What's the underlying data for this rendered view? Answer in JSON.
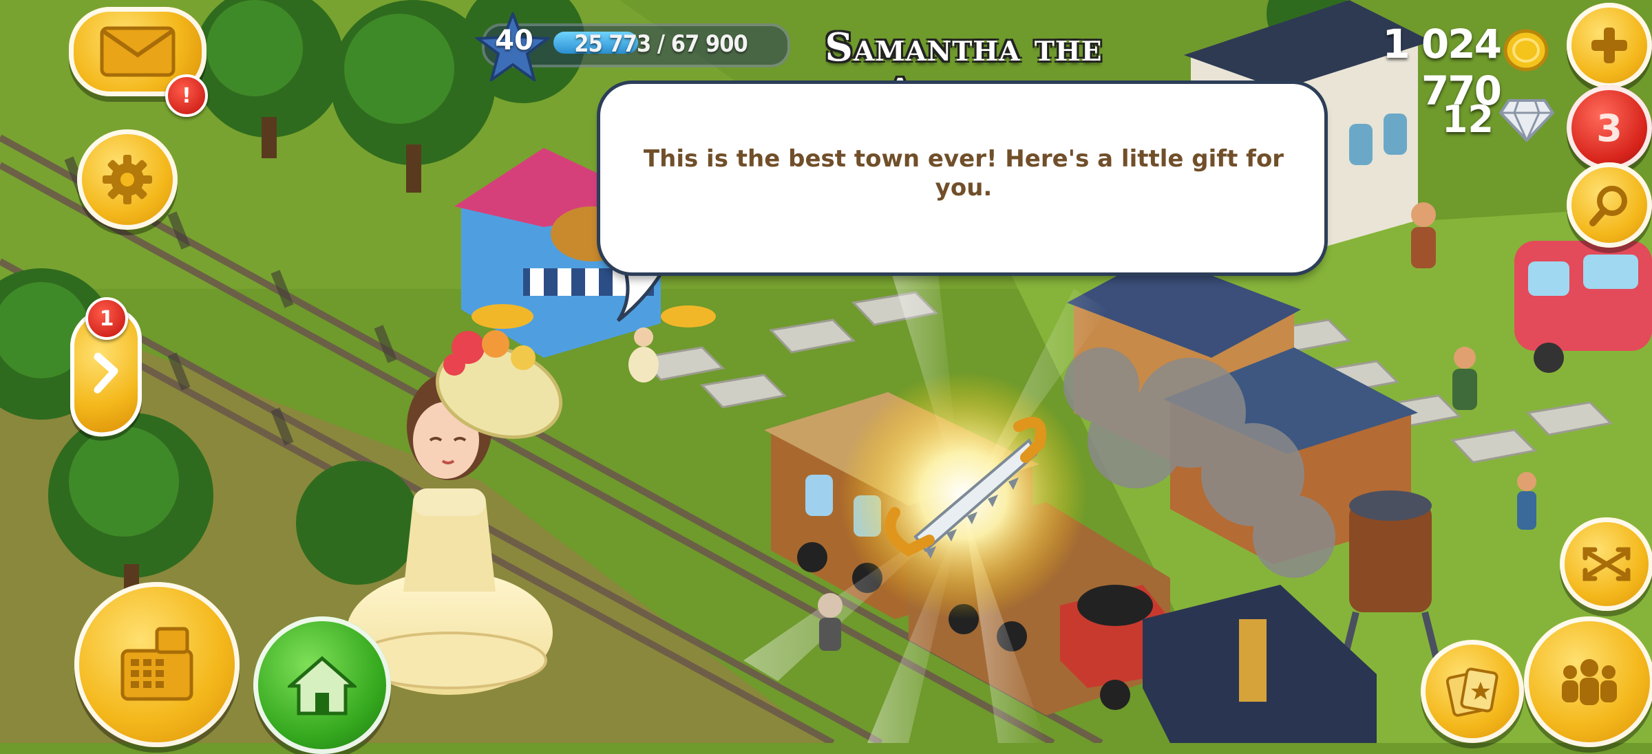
{
  "dialog": {
    "speaker": "Samantha the Actress",
    "message": "This is the best town ever! Here's a little gift for you.",
    "gift_item": "saw-icon"
  },
  "hud": {
    "level": "40",
    "xp": "25 773 / 67 900",
    "xp_fraction": 0.38,
    "coins": "1 024 770",
    "diamonds": "12",
    "notification_count": "3",
    "side_panel_badge": "1",
    "mail_alert": "!"
  },
  "icons": {
    "mail": "envelope-icon",
    "settings": "gear-icon",
    "side_panel": "chevron-right-icon",
    "shop": "cash-register-icon",
    "home": "house-icon",
    "add_coins": "plus-icon",
    "search": "magnifier-icon",
    "zoom": "expand-arrows-icon",
    "cards": "cards-icon",
    "friends": "people-icon"
  },
  "colors": {
    "grass": "#6f9a2c",
    "bubble_text": "#704f2a",
    "button_yellow": "#f4b81c",
    "button_green": "#34a81e",
    "button_red": "#d8251c"
  }
}
